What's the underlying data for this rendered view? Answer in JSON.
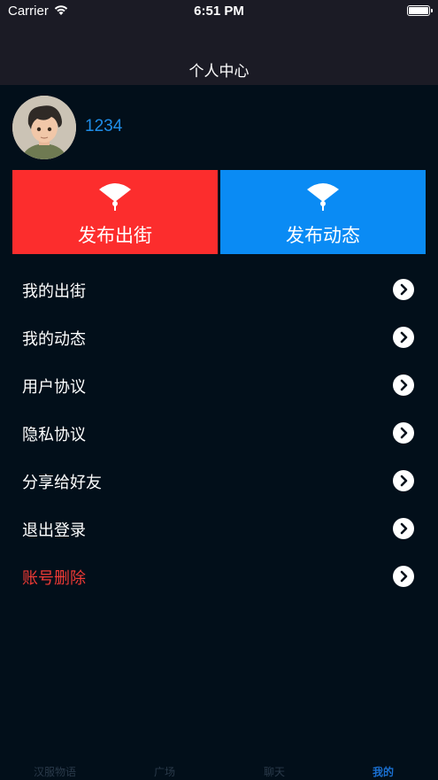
{
  "status_bar": {
    "carrier": "Carrier",
    "time": "6:51 PM",
    "icons": [
      "wifi-icon",
      "battery-icon"
    ]
  },
  "nav": {
    "title": "个人中心"
  },
  "profile": {
    "username": "1234"
  },
  "actions": [
    {
      "label": "发布出街",
      "icon": "fan-icon",
      "color": "#fc2d2d"
    },
    {
      "label": "发布动态",
      "icon": "fan-icon",
      "color": "#0a8bf4"
    }
  ],
  "menu": [
    {
      "label": "我的出街",
      "icon": "chevron-right-icon"
    },
    {
      "label": "我的动态",
      "icon": "chevron-right-icon"
    },
    {
      "label": "用户协议",
      "icon": "chevron-right-icon"
    },
    {
      "label": "隐私协议",
      "icon": "chevron-right-icon"
    },
    {
      "label": "分享给好友",
      "icon": "chevron-right-icon"
    },
    {
      "label": "退出登录",
      "icon": "chevron-right-icon"
    },
    {
      "label": "账号删除",
      "icon": "chevron-right-icon",
      "color": "#ef3a35"
    }
  ],
  "tabs": [
    {
      "label": "汉服物语"
    },
    {
      "label": "广场"
    },
    {
      "label": "聊天"
    },
    {
      "label": "我的",
      "active": true
    }
  ],
  "colors": {
    "background": "#020f1a",
    "nav_background": "#1b1b25",
    "accent": "#1f8de8",
    "danger": "#ef3a35"
  }
}
